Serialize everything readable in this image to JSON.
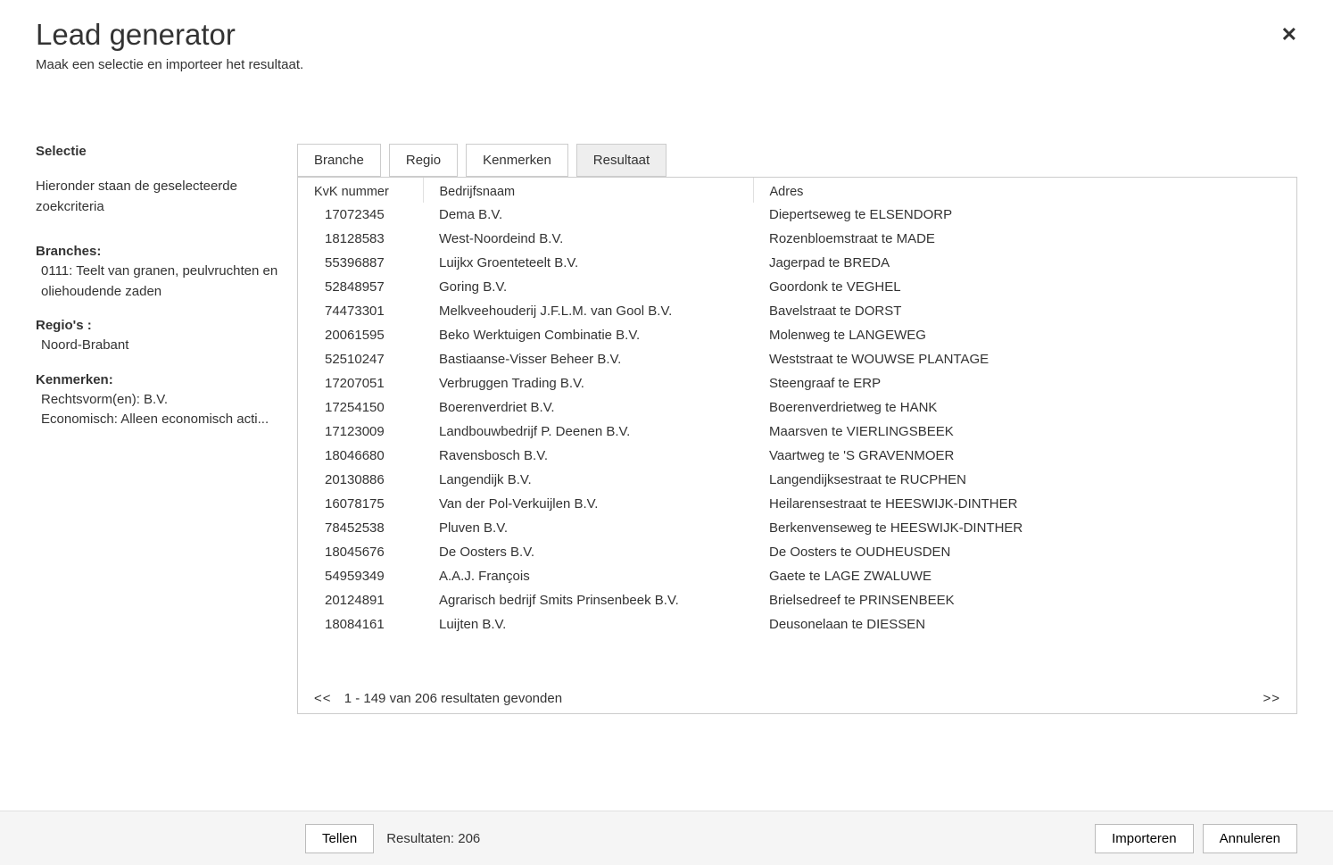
{
  "header": {
    "title": "Lead generator",
    "subtitle": "Maak een selectie en importeer het resultaat."
  },
  "sidebar": {
    "title": "Selectie",
    "description": "Hieronder staan de geselecteerde zoekcriteria",
    "branches_label": "Branches:",
    "branches_value": "0111: Teelt van granen, peulvruchten en oliehoudende zaden",
    "regions_label": "Regio's :",
    "regions_value": "Noord-Brabant",
    "kenmerken_label": "Kenmerken:",
    "kenmerken_value1": "Rechtsvorm(en): B.V.",
    "kenmerken_value2": "Economisch: Alleen economisch acti..."
  },
  "tabs": {
    "branche": "Branche",
    "regio": "Regio",
    "kenmerken": "Kenmerken",
    "resultaat": "Resultaat"
  },
  "table": {
    "headers": {
      "kvk": "KvK nummer",
      "bedrijfsnaam": "Bedrijfsnaam",
      "adres": "Adres"
    },
    "rows": [
      {
        "kvk": "17072345",
        "naam": "Dema B.V.",
        "adres": "Diepertseweg te ELSENDORP"
      },
      {
        "kvk": "18128583",
        "naam": "West-Noordeind B.V.",
        "adres": "Rozenbloemstraat te MADE"
      },
      {
        "kvk": "55396887",
        "naam": "Luijkx Groenteteelt B.V.",
        "adres": "Jagerpad te BREDA"
      },
      {
        "kvk": "52848957",
        "naam": "Goring B.V.",
        "adres": "Goordonk te VEGHEL"
      },
      {
        "kvk": "74473301",
        "naam": "Melkveehouderij J.F.L.M. van Gool B.V.",
        "adres": "Bavelstraat te DORST"
      },
      {
        "kvk": "20061595",
        "naam": "Beko Werktuigen Combinatie B.V.",
        "adres": "Molenweg te LANGEWEG"
      },
      {
        "kvk": "52510247",
        "naam": "Bastiaanse-Visser Beheer B.V.",
        "adres": "Weststraat te WOUWSE PLANTAGE"
      },
      {
        "kvk": "17207051",
        "naam": "Verbruggen Trading B.V.",
        "adres": "Steengraaf te ERP"
      },
      {
        "kvk": "17254150",
        "naam": "Boerenverdriet B.V.",
        "adres": "Boerenverdrietweg te HANK"
      },
      {
        "kvk": "17123009",
        "naam": "Landbouwbedrijf P. Deenen B.V.",
        "adres": "Maarsven te VIERLINGSBEEK"
      },
      {
        "kvk": "18046680",
        "naam": "Ravensbosch B.V.",
        "adres": "Vaartweg te 'S GRAVENMOER"
      },
      {
        "kvk": "20130886",
        "naam": "Langendijk B.V.",
        "adres": "Langendijksestraat te RUCPHEN"
      },
      {
        "kvk": "16078175",
        "naam": "Van der Pol-Verkuijlen B.V.",
        "adres": "Heilarensestraat te HEESWIJK-DINTHER"
      },
      {
        "kvk": "78452538",
        "naam": "Pluven B.V.",
        "adres": "Berkenvenseweg te HEESWIJK-DINTHER"
      },
      {
        "kvk": "18045676",
        "naam": "De Oosters B.V.",
        "adres": "De Oosters te OUDHEUSDEN"
      },
      {
        "kvk": "54959349",
        "naam": "A.A.J. François",
        "adres": "Gaete te LAGE ZWALUWE"
      },
      {
        "kvk": "20124891",
        "naam": "Agrarisch bedrijf Smits Prinsenbeek B.V.",
        "adres": "Brielsedreef te PRINSENBEEK"
      },
      {
        "kvk": "18084161",
        "naam": "Luijten B.V.",
        "adres": "Deusonelaan te DIESSEN"
      }
    ]
  },
  "pagination": {
    "prev": "<<",
    "info": "1 - 149 van 206 resultaten gevonden",
    "next": ">>"
  },
  "footer": {
    "tellen": "Tellen",
    "resultaten": "Resultaten: 206",
    "importeren": "Importeren",
    "annuleren": "Annuleren"
  }
}
